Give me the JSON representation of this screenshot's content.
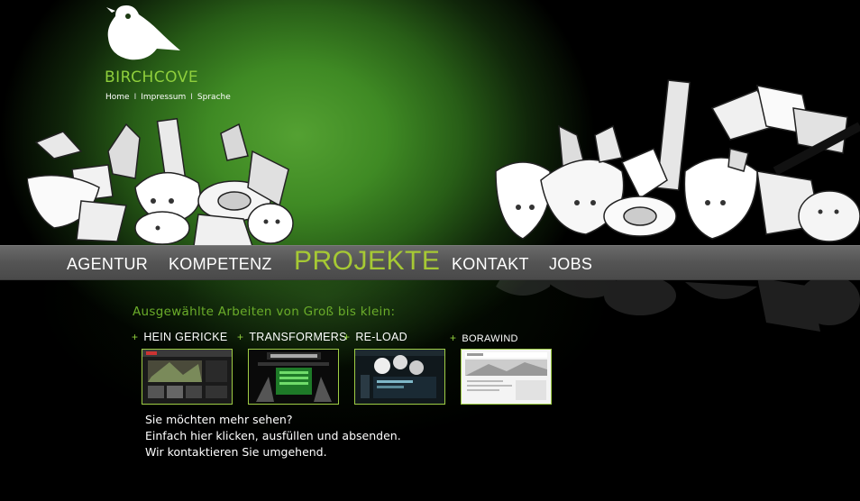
{
  "brand": {
    "name": "BIRCHCOVE",
    "logo_icon": "bird-icon"
  },
  "topnav": {
    "home": "Home",
    "separator": "I",
    "impressum": "Impressum",
    "sprache": "Sprache"
  },
  "mainnav": {
    "agentur": "AGENTUR",
    "kompetenz": "KOMPETENZ",
    "projekte": "PROJEKTE",
    "kontakt": "KONTAKT",
    "jobs": "JOBS",
    "active": "projekte"
  },
  "content": {
    "subtitle": "Ausgewählte Arbeiten von Groß bis klein:",
    "projects": [
      {
        "label": "HEIN GERICKE"
      },
      {
        "label": "TRANSFORMERS"
      },
      {
        "label": "RE-LOAD"
      },
      {
        "label": "BORAWIND"
      }
    ],
    "cta": {
      "line1": "Sie möchten mehr sehen?",
      "line2": "Einfach hier klicken, ausfüllen und absenden.",
      "line3": "Wir kontaktieren Sie umgehend."
    }
  },
  "colors": {
    "accent_green": "#8fcf3c",
    "active_nav": "#a6c934",
    "nav_band": "#5a5a5a",
    "background": "#000000"
  }
}
